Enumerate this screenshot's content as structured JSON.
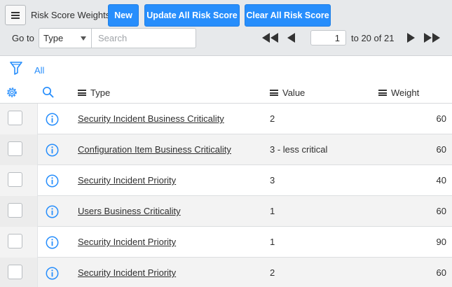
{
  "header": {
    "title": "Risk Score Weights",
    "buttons": {
      "new_label": "New",
      "update_label": "Update All Risk Score",
      "clear_label": "Clear All Risk Score"
    },
    "goto_label": "Go to",
    "field_select": "Type",
    "search_placeholder": "Search"
  },
  "pagination": {
    "current_page": "1",
    "range_text": "to 20 of 21"
  },
  "filter": {
    "label": "All"
  },
  "columns": {
    "type": "Type",
    "value": "Value",
    "weight": "Weight"
  },
  "rows": [
    {
      "type": "Security Incident Business Criticality",
      "value": "2",
      "weight": "60"
    },
    {
      "type": "Configuration Item Business Criticality",
      "value": "3 - less critical",
      "weight": "60"
    },
    {
      "type": "Security Incident Priority",
      "value": "3",
      "weight": "40"
    },
    {
      "type": "Users Business Criticality",
      "value": "1",
      "weight": "60"
    },
    {
      "type": "Security Incident Priority",
      "value": "1",
      "weight": "90"
    },
    {
      "type": "Security Incident Priority",
      "value": "2",
      "weight": "60"
    }
  ],
  "colors": {
    "accent": "#278efc",
    "header_bg": "#e7e9eb",
    "alt_row_bg": "#f3f3f3"
  }
}
